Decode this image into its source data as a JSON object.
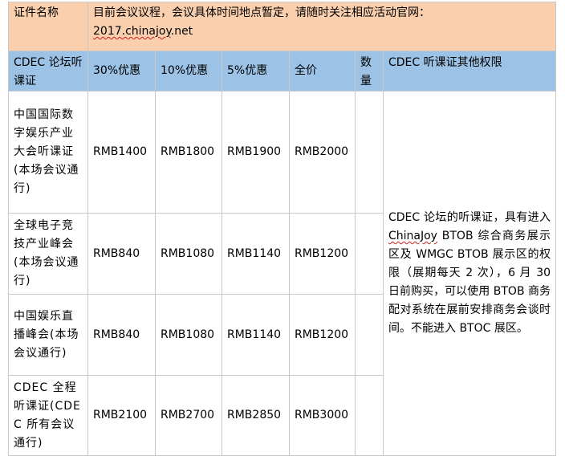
{
  "notice": {
    "label": "证件名称",
    "text_before": "目前会议议程，会议具体时间地点暂定，请随时关注相应活动官网：",
    "link_text": "2017.chinajoy",
    "link_suffix": ".net"
  },
  "headers": {
    "pass_type": "CDEC 论坛听课证",
    "discount_30": "30%优惠",
    "discount_10": "10%优惠",
    "discount_5": "5%优惠",
    "full_price": "全价",
    "quantity": "数量",
    "other_rights": "CDEC 听课证其他权限"
  },
  "rows": [
    {
      "name": "中国国际数字娱乐产业大会听课证(本场会议通行)",
      "p30": "RMB1400",
      "p10": "RMB1800",
      "p5": "RMB1900",
      "full": "RMB2000",
      "qty": ""
    },
    {
      "name": "全球电子竞技产业峰会(本场会议通行)",
      "p30": "RMB840",
      "p10": "RMB1080",
      "p5": "RMB1140",
      "full": "RMB1200",
      "qty": ""
    },
    {
      "name": "中国娱乐直播峰会(本场会议通行)",
      "p30": "RMB840",
      "p10": "RMB1080",
      "p5": "RMB1140",
      "full": "RMB1200",
      "qty": ""
    },
    {
      "name": "CDEC 全程听课证(CDEC 所有会议通行)",
      "p30": "RMB2100",
      "p10": "RMB2700",
      "p5": "RMB2850",
      "full": "RMB3000",
      "qty": ""
    }
  ],
  "benefits": {
    "text_before": "CDEC 论坛的听课证，具有进入 ",
    "brand": "ChinaJoy",
    "text_after": " BTOB 综合商务展示区及 WMGC BTOB 展示区的权限（展期每天 2 次），6 月 30 日前购买，可以使用 BTOB 商务配对系统在展前安排商务会谈时间。不能进入 BTOC 展区。"
  }
}
